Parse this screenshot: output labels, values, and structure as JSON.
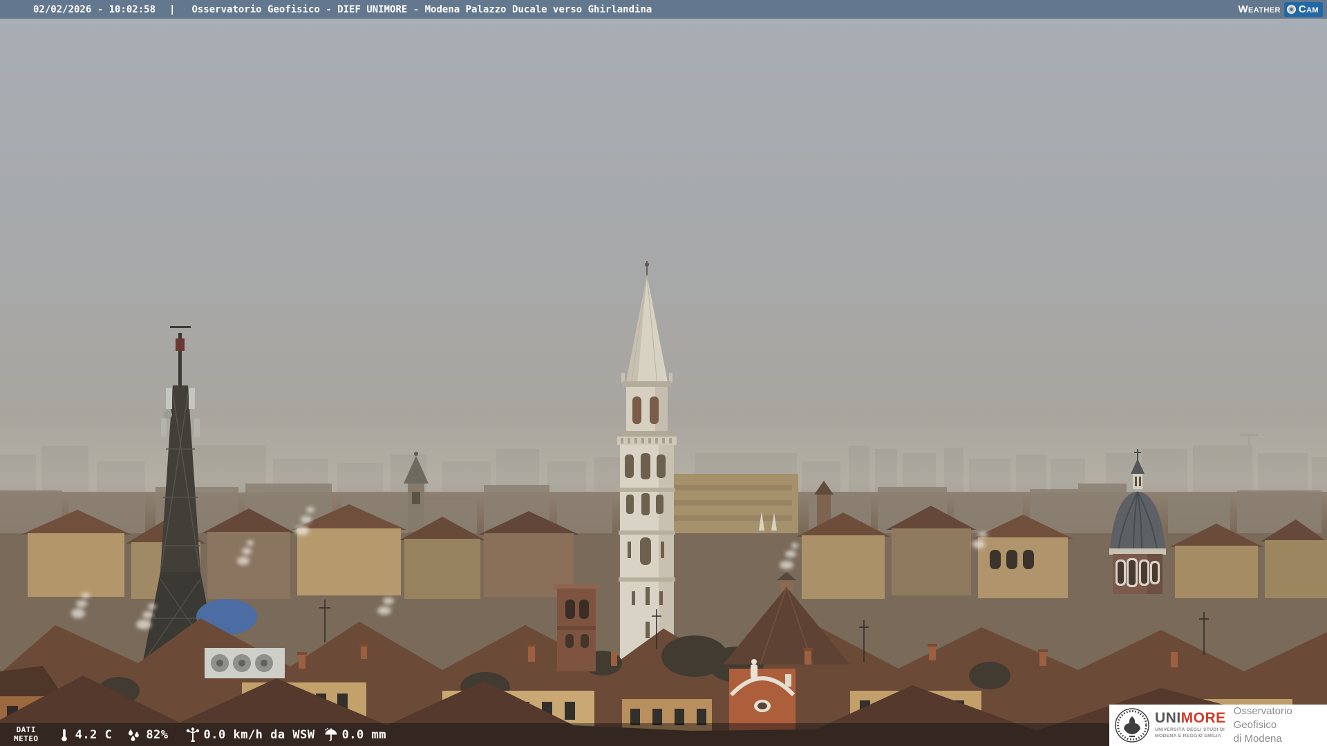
{
  "header": {
    "datetime": "02/02/2026 - 10:02:58",
    "separator": "|",
    "title": "Osservatorio Geofisico - DIEF UNIMORE - Modena Palazzo Ducale verso Ghirlandina",
    "bar_color": "#63788e",
    "text_color": "#ffffff",
    "logo": {
      "weather": "Weather",
      "cam": "Cam",
      "tag_color": "#2268a4"
    }
  },
  "meteo_bar": {
    "label": {
      "line1": "DATI",
      "line2": "METEO"
    },
    "temperature": {
      "icon": "thermometer-icon",
      "value": "4.2 C"
    },
    "humidity": {
      "icon": "humidity-drops-icon",
      "value": "82%"
    },
    "wind": {
      "icon": "anemometer-icon",
      "value": "0.0 km/h da WSW"
    },
    "precipitation": {
      "icon": "umbrella-icon",
      "value": "0.0 mm"
    },
    "bg_color": "rgba(10,12,16,0.42)"
  },
  "branding_panel": {
    "seal": "unimore-seal-icon",
    "wordmark": {
      "uni": "UNI",
      "more": "MORE",
      "uni_color": "#55565a",
      "more_color": "#d23b27"
    },
    "subtitle": {
      "line1": "UNIVERSITÀ DEGLI STUDI DI",
      "line2": "MODENA E REGGIO EMILIA"
    },
    "organization": {
      "line1": "Osservatorio Geofisico",
      "line2": "di Modena",
      "color": "#8d8d8d"
    },
    "bg_color": "#ffffff"
  },
  "scene": {
    "description": "Hazy winter morning webcam view over the rooftops of Modena toward the Ghirlandina tower",
    "landmarks": [
      "telecom-lattice-tower",
      "ghirlandina-tower",
      "san-carlo-spire",
      "chiesa-del-voto-dome",
      "terracotta-rooftops",
      "steam-plumes",
      "hazy-skyline"
    ],
    "sky_top_color": "#a8aeb6",
    "sky_horizon_color": "#a9a49a"
  }
}
